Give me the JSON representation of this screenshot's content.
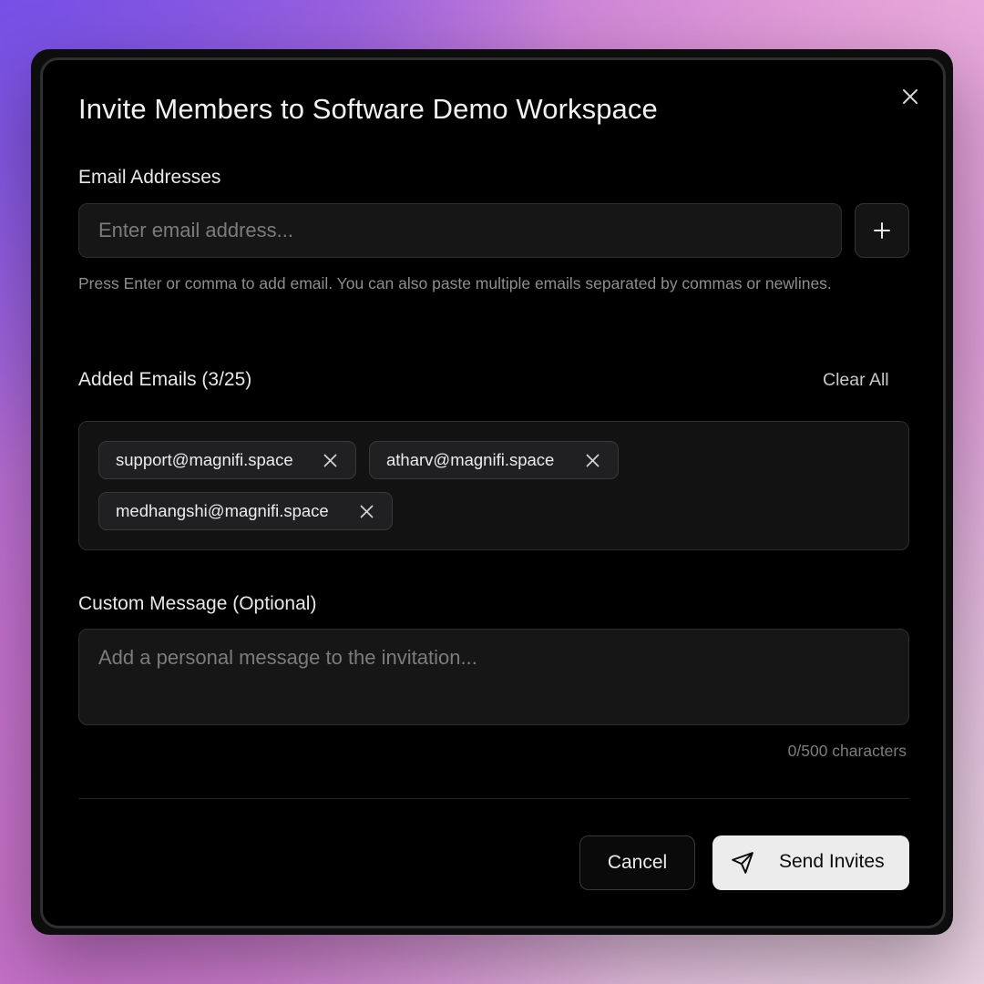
{
  "dialog": {
    "title": "Invite Members to Software Demo Workspace",
    "close_icon": "close-icon"
  },
  "email_section": {
    "label": "Email Addresses",
    "input_placeholder": "Enter email address...",
    "input_value": "",
    "add_icon": "plus-icon",
    "helper_text": "Press Enter or comma to add email. You can also paste multiple emails separated by commas or newlines."
  },
  "added_emails": {
    "label": "Added Emails (3/25)",
    "clear_all_label": "Clear All",
    "emails": [
      "support@magnifi.space",
      "atharv@magnifi.space",
      "medhangshi@magnifi.space"
    ],
    "remove_icon": "close-icon"
  },
  "message_section": {
    "label": "Custom Message (Optional)",
    "placeholder": "Add a personal message to the invitation...",
    "value": "",
    "counter": "0/500 characters"
  },
  "footer": {
    "cancel_label": "Cancel",
    "send_label": "Send Invites",
    "send_icon": "send-icon"
  },
  "colors": {
    "dialog_bg": "#000000",
    "field_bg": "#161616",
    "primary_button_bg": "#ececec",
    "text": "#ececec",
    "muted_text": "#8e8e90"
  }
}
